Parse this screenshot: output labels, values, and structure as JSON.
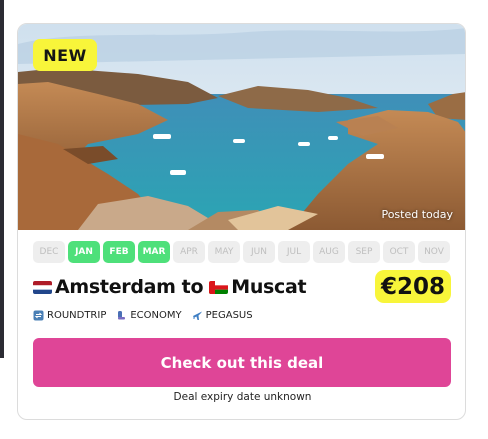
{
  "card": {
    "badge": "NEW",
    "posted": "Posted today",
    "months": [
      {
        "label": "DEC",
        "active": false
      },
      {
        "label": "JAN",
        "active": true
      },
      {
        "label": "FEB",
        "active": true
      },
      {
        "label": "MAR",
        "active": true
      },
      {
        "label": "APR",
        "active": false
      },
      {
        "label": "MAY",
        "active": false
      },
      {
        "label": "JUN",
        "active": false
      },
      {
        "label": "JUL",
        "active": false
      },
      {
        "label": "AUG",
        "active": false
      },
      {
        "label": "SEP",
        "active": false
      },
      {
        "label": "OCT",
        "active": false
      },
      {
        "label": "NOV",
        "active": false
      }
    ],
    "route": {
      "origin": "Amsterdam",
      "connector": "to",
      "destination": "Muscat",
      "origin_flag": "netherlands-flag-icon",
      "destination_flag": "oman-flag-icon"
    },
    "price": "€208",
    "tags": [
      {
        "label": "ROUNDTRIP",
        "icon": "roundtrip-icon"
      },
      {
        "label": "ECONOMY",
        "icon": "seat-icon"
      },
      {
        "label": "PEGASUS",
        "icon": "airplane-icon"
      }
    ],
    "cta_label": "Check out this deal",
    "expiry": "Deal expiry date unknown"
  },
  "colors": {
    "badge": "#f8f53a",
    "month_active": "#4ee07a",
    "month_inactive": "#eeeeee",
    "cta": "#df4597"
  }
}
